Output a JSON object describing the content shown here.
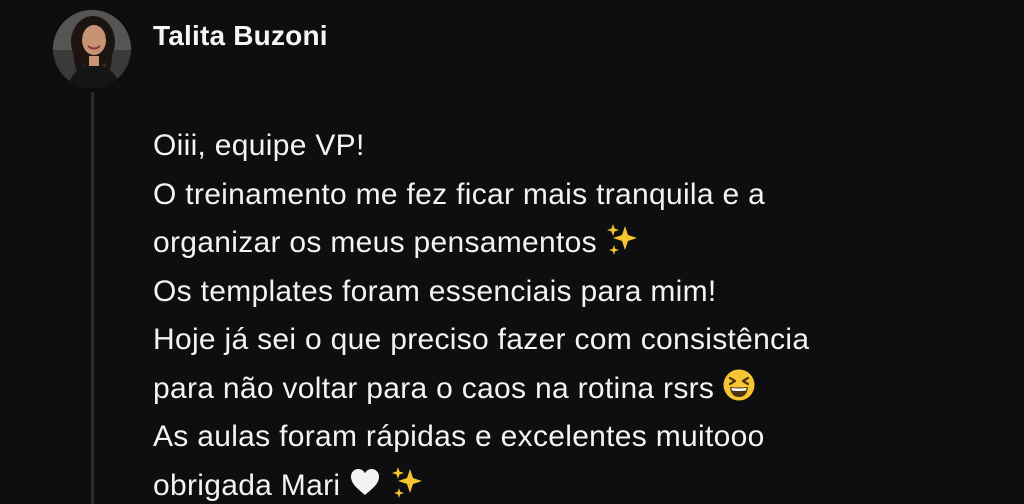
{
  "post": {
    "author": "Talita Buzoni",
    "avatar_icon": "profile-photo",
    "lines": [
      "Oiii, equipe VP!",
      "O treinamento me fez ficar mais tranquila e a",
      "organizar os meus pensamentos",
      "Os templates foram essenciais para mim!",
      "Hoje já sei o que preciso fazer com consistência",
      "para não voltar para o caos na rotina rsrs",
      "As aulas foram rápidas e excelentes muitooo",
      "obrigada Mari"
    ],
    "emojis": {
      "line3": "sparkles-emoji",
      "line6": "grinning-squinting-face-emoji",
      "line8": [
        "white-heart-emoji",
        "sparkles-emoji"
      ]
    }
  },
  "colors": {
    "background": "#0e0d10",
    "text": "#f3f3f3",
    "thread_line": "#2a2a2d",
    "sparkle": "#f6c52e"
  }
}
